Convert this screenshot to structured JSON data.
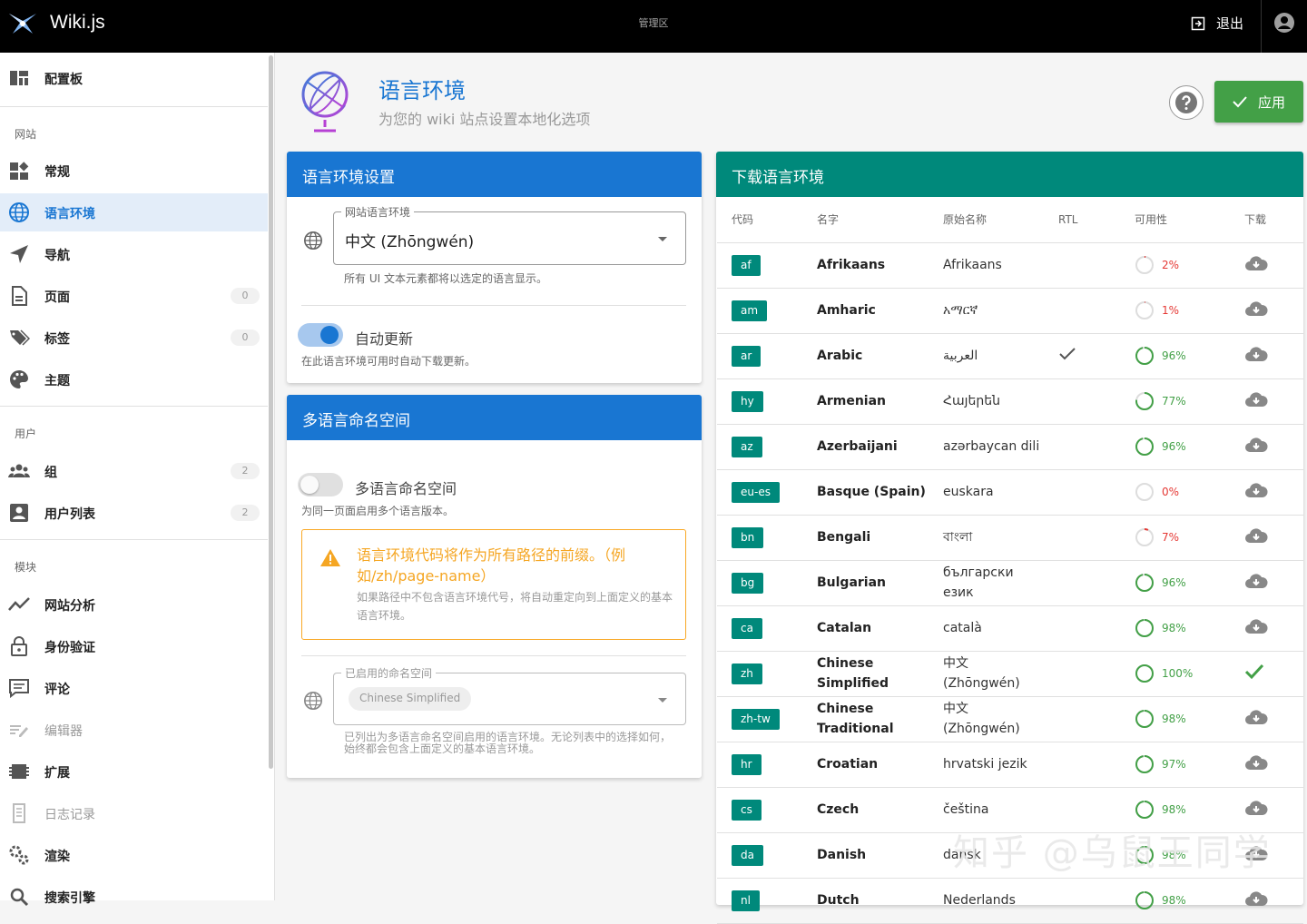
{
  "topbar": {
    "brand": "Wiki.js",
    "section": "管理区",
    "logout": "退出"
  },
  "sidebar": {
    "dashboard": "配置板",
    "section_site": "网站",
    "site_items": [
      {
        "label": "常规",
        "icon": "general-icon"
      },
      {
        "label": "语言环境",
        "icon": "globe-icon"
      },
      {
        "label": "导航",
        "icon": "navigation-icon"
      },
      {
        "label": "页面",
        "icon": "pages-icon",
        "badge": "0"
      },
      {
        "label": "标签",
        "icon": "tags-icon",
        "badge": "0"
      },
      {
        "label": "主题",
        "icon": "palette-icon"
      }
    ],
    "section_users": "用户",
    "user_items": [
      {
        "label": "组",
        "icon": "groups-icon",
        "badge": "2"
      },
      {
        "label": "用户列表",
        "icon": "users-icon",
        "badge": "2"
      }
    ],
    "section_modules": "模块",
    "module_items": [
      {
        "label": "网站分析",
        "icon": "analytics-icon"
      },
      {
        "label": "身份验证",
        "icon": "lock-icon"
      },
      {
        "label": "评论",
        "icon": "comments-icon"
      },
      {
        "label": "编辑器",
        "icon": "editor-icon"
      },
      {
        "label": "扩展",
        "icon": "extensions-icon"
      },
      {
        "label": "日志记录",
        "icon": "logging-icon"
      },
      {
        "label": "渲染",
        "icon": "rendering-icon"
      },
      {
        "label": "搜索引擎",
        "icon": "search-engine-icon"
      }
    ]
  },
  "header": {
    "title": "语言环境",
    "subtitle": "为您的 wiki 站点设置本地化选项",
    "apply": "应用"
  },
  "locale_settings": {
    "title": "语言环境设置",
    "site_locale_label": "网站语言环境",
    "site_locale_value": "中文 (Zhōngwén)",
    "site_locale_hint": "所有 UI 文本元素都将以选定的语言显示。",
    "auto_update_label": "自动更新",
    "auto_update_on": true,
    "auto_update_hint": "在此语言环境可用时自动下载更新。"
  },
  "namespaces": {
    "title": "多语言命名空间",
    "toggle_label": "多语言命名空间",
    "toggle_on": false,
    "toggle_hint": "为同一页面启用多个语言版本。",
    "warn_title": "语言环境代码将作为所有路径的前缀。（例如/zh/page-name）",
    "warn_text": "如果路径中不包含语言环境代号，将自动重定向到上面定义的基本语言环境。",
    "enabled_label": "已启用的命名空间",
    "enabled_chip": "Chinese Simplified",
    "enabled_hint": "已列出为多语言命名空间启用的语言环境。无论列表中的选择如何，始终都会包含上面定义的基本语言环境。"
  },
  "download": {
    "title": "下载语言环境",
    "columns": [
      "代码",
      "名字",
      "原始名称",
      "RTL",
      "可用性",
      "下载"
    ],
    "rows": [
      {
        "code": "af",
        "name": "Afrikaans",
        "native": "Afrikaans",
        "rtl": false,
        "avail": 2,
        "availText": "2%",
        "installed": false
      },
      {
        "code": "am",
        "name": "Amharic",
        "native": "አማርኛ",
        "rtl": false,
        "avail": 1,
        "availText": "1%",
        "installed": false
      },
      {
        "code": "ar",
        "name": "Arabic",
        "native": "العربية",
        "rtl": true,
        "avail": 96,
        "availText": "96%",
        "installed": false
      },
      {
        "code": "hy",
        "name": "Armenian",
        "native": "Հայերեն",
        "rtl": false,
        "avail": 77,
        "availText": "77%",
        "installed": false
      },
      {
        "code": "az",
        "name": "Azerbaijani",
        "native": "azərbaycan dili",
        "rtl": false,
        "avail": 96,
        "availText": "96%",
        "installed": false
      },
      {
        "code": "eu-es",
        "name": "Basque (Spain)",
        "native": "euskara",
        "rtl": false,
        "avail": 0,
        "availText": "0%",
        "installed": false
      },
      {
        "code": "bn",
        "name": "Bengali",
        "native": "বাংলা",
        "rtl": false,
        "avail": 7,
        "availText": "7%",
        "installed": false
      },
      {
        "code": "bg",
        "name": "Bulgarian",
        "native": "български език",
        "rtl": false,
        "avail": 96,
        "availText": "96%",
        "installed": false
      },
      {
        "code": "ca",
        "name": "Catalan",
        "native": "català",
        "rtl": false,
        "avail": 98,
        "availText": "98%",
        "installed": false
      },
      {
        "code": "zh",
        "name": "Chinese Simplified",
        "native": "中文 (Zhōngwén)",
        "rtl": false,
        "avail": 100,
        "availText": "100%",
        "installed": true
      },
      {
        "code": "zh-tw",
        "name": "Chinese Traditional",
        "native": "中文 (Zhōngwén)",
        "rtl": false,
        "avail": 98,
        "availText": "98%",
        "installed": false
      },
      {
        "code": "hr",
        "name": "Croatian",
        "native": "hrvatski jezik",
        "rtl": false,
        "avail": 97,
        "availText": "97%",
        "installed": false
      },
      {
        "code": "cs",
        "name": "Czech",
        "native": "čeština",
        "rtl": false,
        "avail": 98,
        "availText": "98%",
        "installed": false
      },
      {
        "code": "da",
        "name": "Danish",
        "native": "dansk",
        "rtl": false,
        "avail": 98,
        "availText": "98%",
        "installed": false
      },
      {
        "code": "nl",
        "name": "Dutch",
        "native": "Nederlands",
        "rtl": false,
        "avail": 98,
        "availText": "98%",
        "installed": false
      }
    ]
  },
  "watermark": "知乎 @乌鼠王同学",
  "colors": {
    "primary": "#1976d2",
    "teal": "#00897b",
    "success": "#43a047",
    "warning": "#f5a623",
    "red": "#e53935"
  }
}
